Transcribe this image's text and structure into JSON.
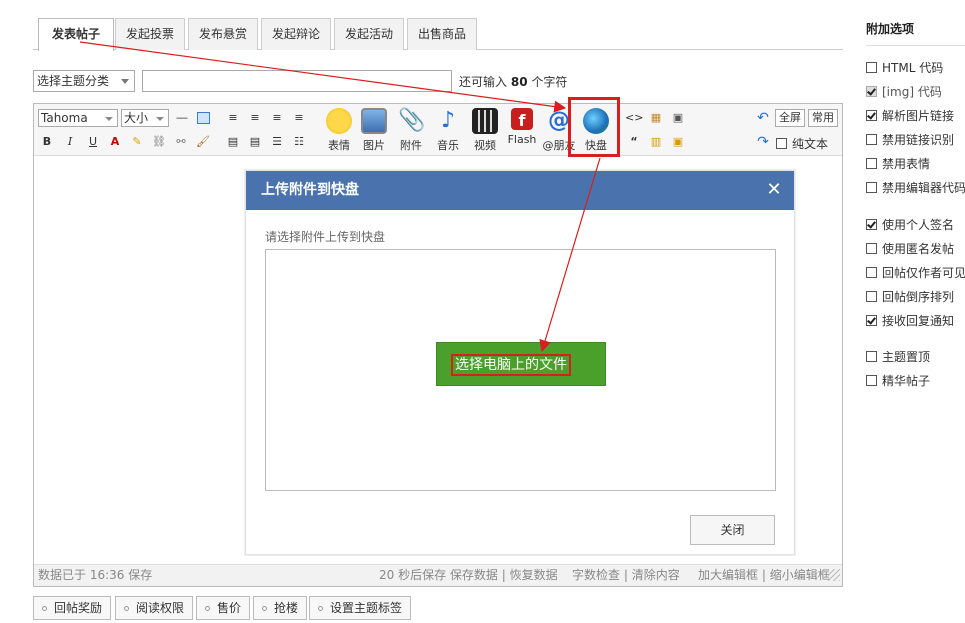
{
  "tabs": [
    {
      "label": "发表帖子",
      "active": true
    },
    {
      "label": "发起投票",
      "active": false
    },
    {
      "label": "发布悬赏",
      "active": false
    },
    {
      "label": "发起辩论",
      "active": false
    },
    {
      "label": "发起活动",
      "active": false
    },
    {
      "label": "出售商品",
      "active": false
    }
  ],
  "subject": {
    "category_select": "选择主题分类",
    "title_value": "",
    "hint_prefix": "还可输入",
    "hint_count": "80",
    "hint_suffix": "个字符"
  },
  "toolbar": {
    "font": "Tahoma",
    "size": "大小",
    "buttons": [
      {
        "label": "表情",
        "icon": "smiley-icon"
      },
      {
        "label": "图片",
        "icon": "image-icon"
      },
      {
        "label": "附件",
        "icon": "paperclip-icon"
      },
      {
        "label": "音乐",
        "icon": "music-note-icon"
      },
      {
        "label": "视频",
        "icon": "film-icon"
      },
      {
        "label": "Flash",
        "icon": "flash-icon"
      },
      {
        "label": "@朋友",
        "icon": "at-icon"
      },
      {
        "label": "快盘",
        "icon": "kuaipan-icon"
      }
    ],
    "fullscreen": "全屏",
    "common": "常用",
    "plain_text": "纯文本"
  },
  "statusbar": {
    "saved_at": "数据已于 16:36 保存",
    "autosave": "20 秒后保存 保存数据",
    "restore": "恢复数据",
    "word_check": "字数检查",
    "clear": "清除内容",
    "enlarge": "加大编辑框",
    "shrink": "缩小编辑框"
  },
  "modal": {
    "title": "上传附件到快盘",
    "prompt": "请选择附件上传到快盘",
    "choose_button": "选择电脑上的文件",
    "close_button": "关闭"
  },
  "bottom_buttons": [
    "回帖奖励",
    "阅读权限",
    "售价",
    "抢楼",
    "设置主题标签"
  ],
  "options": {
    "title": "附加选项",
    "groups": [
      [
        {
          "label": "HTML 代码",
          "checked": false,
          "disabled": false
        },
        {
          "label": "[img] 代码",
          "checked": true,
          "disabled": true
        },
        {
          "label": "解析图片链接",
          "checked": true,
          "disabled": false
        },
        {
          "label": "禁用链接识别",
          "checked": false,
          "disabled": false
        },
        {
          "label": "禁用表情",
          "checked": false,
          "disabled": false
        },
        {
          "label": "禁用编辑器代码",
          "checked": false,
          "disabled": false
        }
      ],
      [
        {
          "label": "使用个人签名",
          "checked": true,
          "disabled": false
        },
        {
          "label": "使用匿名发帖",
          "checked": false,
          "disabled": false
        },
        {
          "label": "回帖仅作者可见",
          "checked": false,
          "disabled": false
        },
        {
          "label": "回帖倒序排列",
          "checked": false,
          "disabled": false
        },
        {
          "label": "接收回复通知",
          "checked": true,
          "disabled": false
        }
      ],
      [
        {
          "label": "主题置顶",
          "checked": false,
          "disabled": false
        },
        {
          "label": "精华帖子",
          "checked": false,
          "disabled": false
        }
      ]
    ]
  },
  "colors": {
    "modal_header": "#4a73ad",
    "choose_button": "#4aa02a",
    "highlight": "#d81e1e"
  }
}
